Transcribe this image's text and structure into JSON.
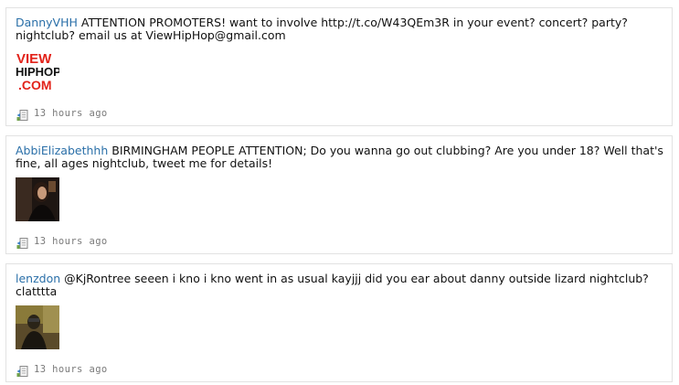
{
  "tweets": [
    {
      "username": "DannyVHH",
      "text": " ATTENTION PROMOTERS! want to involve http://t.co/W43QEm3R in your event? concert? party? nightclub? email us at ViewHipHop@gmail.com",
      "avatar_logo": {
        "line1": "VIEW",
        "line2": "HIPHOP",
        "line3": ".COM"
      },
      "timestamp": "13 hours ago",
      "meta_icon": "reply-document-icon"
    },
    {
      "username": "AbbiElizabethhh",
      "text": " BIRMINGHAM PEOPLE ATTENTION; Do you wanna go out clubbing? Are you under 18? Well that's fine, all ages nightclub, tweet me for details!",
      "timestamp": "13 hours ago",
      "meta_icon": "reply-document-icon"
    },
    {
      "username": "lenzdon",
      "text": " @KjRontree seeen i kno i kno went in as usual kayjjj did you ear about danny outside lizard nightclub? clatttta",
      "timestamp": "13 hours ago",
      "meta_icon": "reply-document-icon"
    }
  ],
  "colors": {
    "username_link": "#2a6fa8",
    "body_text": "#111111",
    "timestamp": "#7a7a7a",
    "card_border": "#e2e2e2",
    "logo_red": "#e2231a"
  }
}
